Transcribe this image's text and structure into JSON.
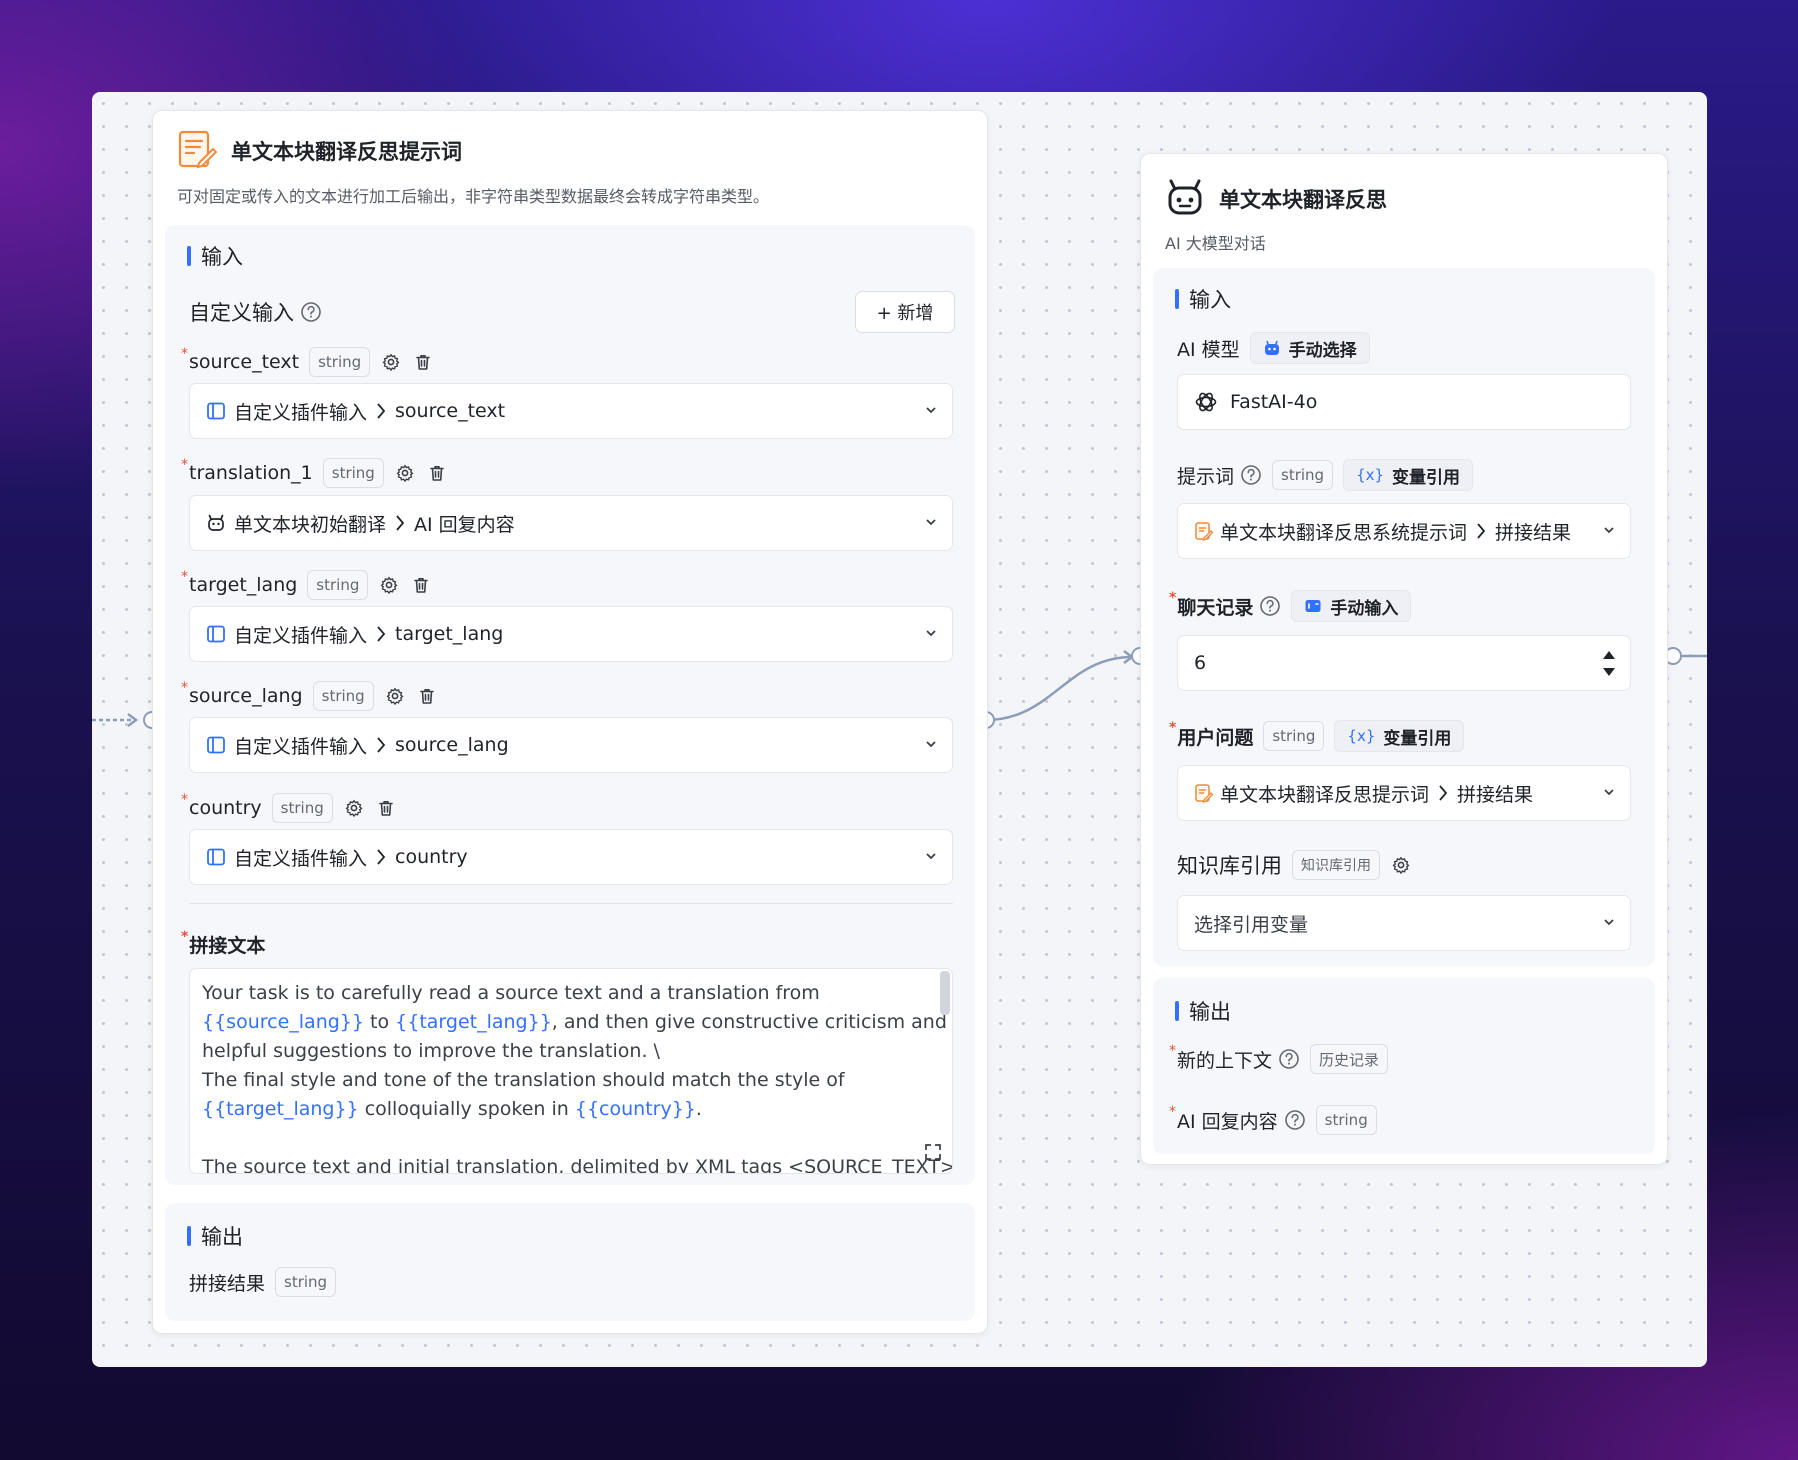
{
  "left_node": {
    "title": "单文本块翻译反思提示词",
    "description": "可对固定或传入的文本进行加工后输出，非字符串类型数据最终会转成字符串类型。",
    "input_section": {
      "label": "输入",
      "custom_input_label": "自定义输入",
      "add_button": "+ 新增",
      "fields": [
        {
          "name": "source_text",
          "type": "string",
          "source": "自定义插件输入",
          "value": "source_text"
        },
        {
          "name": "translation_1",
          "type": "string",
          "source": "单文本块初始翻译",
          "value": "AI 回复内容"
        },
        {
          "name": "target_lang",
          "type": "string",
          "source": "自定义插件输入",
          "value": "target_lang"
        },
        {
          "name": "source_lang",
          "type": "string",
          "source": "自定义插件输入",
          "value": "source_lang"
        },
        {
          "name": "country",
          "type": "string",
          "source": "自定义插件输入",
          "value": "country"
        }
      ],
      "concat_label": "拼接文本",
      "concat_text": {
        "l1": "Your task is to carefully read a source text and a translation from",
        "l2_var1": "{{source_lang}}",
        "l2_mid": " to ",
        "l2_var2": "{{target_lang}}",
        "l2_end": ", and then give constructive criticism and",
        "l3": "helpful suggestions to improve the translation. \\",
        "l4": "The final style and tone of the translation should match the style of",
        "l5_var1": "{{target_lang}}",
        "l5_mid": " colloquially spoken in ",
        "l5_var2": "{{country}}",
        "l5_end": ".",
        "l7": "The source text and initial translation, delimited by XML tags <SOURCE_TEXT>"
      }
    },
    "output_section": {
      "label": "输出",
      "result_label": "拼接结果",
      "result_type": "string"
    }
  },
  "right_node": {
    "title": "单文本块翻译反思",
    "description": "AI 大模型对话",
    "input_section": {
      "label": "输入",
      "model_label": "AI 模型",
      "model_mode": "手动选择",
      "model_value": "FastAI-4o",
      "prompt_label": "提示词",
      "prompt_type": "string",
      "prompt_mode": "变量引用",
      "prompt_source": "单文本块翻译反思系统提示词",
      "prompt_value": "拼接结果",
      "history_label": "聊天记录",
      "history_mode": "手动输入",
      "history_value": "6",
      "question_label": "用户问题",
      "question_type": "string",
      "question_mode": "变量引用",
      "question_source": "单文本块翻译反思提示词",
      "question_value": "拼接结果",
      "kb_label": "知识库引用",
      "kb_tag": "知识库引用",
      "kb_placeholder": "选择引用变量"
    },
    "output_section": {
      "label": "输出",
      "context_label": "新的上下文",
      "context_tag": "历史记录",
      "reply_label": "AI 回复内容",
      "reply_type": "string"
    }
  },
  "colors": {
    "accent": "#3370ff",
    "required": "#e8513a",
    "wire": "#8c9db8",
    "prompt_icon": "#f08a3c"
  }
}
